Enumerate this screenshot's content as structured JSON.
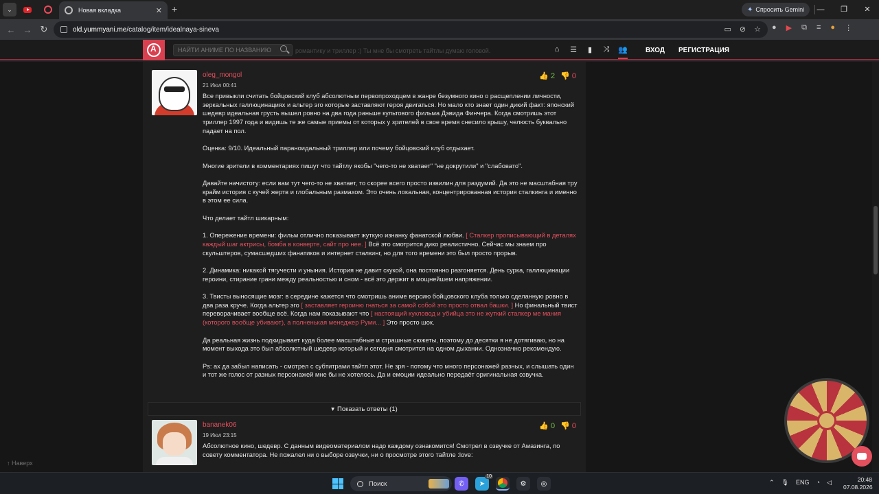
{
  "browser": {
    "active_tab_title": "Новая вкладка",
    "gemini_button": "Спросить Gemini",
    "url_domain": "old.yummyani.me",
    "url_path": "/catalog/item/idealnaya-sineva"
  },
  "site": {
    "search_placeholder": "НАЙТИ АНИМЕ ПО НАЗВАНИЮ",
    "ghost_text": "романтику и триллер :) Ты мне бы смотреть тайтлы думаю головой.",
    "login": "ВХОД",
    "register": "РЕГИСТРАЦИЯ",
    "to_top": "↑ Наверх"
  },
  "comments": [
    {
      "username": "oleg_mongol",
      "date": "21 Июл 00:41",
      "likes": "2",
      "dislikes": "0",
      "p1": "Все привыкли считать бойцовский клуб абсолютным первопроходцем в жанре безумного кино о расщеплении личности, зеркальных галлюцинациях и альтер эго которые заставляют героя двигаться. Но мало кто знает один дикий факт: японский шедевр идеальная грусть вышел ровно на два года раньше культового фильма Дэвида Финчера. Когда смотришь этот триллер 1997 года и видишь те же самые приемы от которых у зрителей в свое время снесило крышу, челюсть буквально падает на пол.",
      "p2": "Оценка: 9/10. Идеальный параноидальный триллер или почему бойцовский клуб отдыхает.",
      "p3": "Многие зрители в комментариях пишут что тайтлу якобы \"чего-то не хватает\" \"не докрутили\" и \"слабовато\".",
      "p4": "Давайте начистоту: если вам тут чего-то не хватает, то скорее всего просто извилин для раздумий. Да это не масштабная тру крайм история с кучей жертв и глобальным размахом. Это очень локальная, концентрированная история сталкинга и именно в этом ее сила.",
      "p5": "Что делает тайтл шикарным:",
      "p6a": " 1. Опережение времени: фильм отлично показывает жуткую изнанку фанатской любви. ",
      "p6b": "[ Сталкер прописывающий в деталях каждый шаг актрисы, бомба в конверте, сайт про нее. ]",
      "p6c": " Всё это смотрится дико реалистично. Сейчас мы знаем про скульштеров, сумасшедших фанатиков и интернет сталкинг, но для того времени это был просто прорыв.",
      "p7": " 2. Динамика: никакой тягучести и уныния. История не давит скукой, она постоянно разгоняется. День сурка, галлюцинации героини, стирание грани между реальностью и сном - всё это держит в мощнейшем напряжении.",
      "p8a": " 3. Твисты выносящие мозг: в середине кажется что смотришь аниме версию бойцовского клуба только сделанную ровно в два раза круче. Когда альтер эго ",
      "p8b": "[ заставляет героиню гнаться за самой собой это просто отвал башки. ]",
      "p8c": " Но финальный твист переворачивает вообще всё. Когда нам показывают что ",
      "p8d": "[ настоящий кукловод и убийца это не жуткий сталкер ме мания (которого вообще убивают), а полненькая менеджер Руми... ]",
      "p8e": " Это просто шок.",
      "p9": "Да реальная жизнь подкидывает куда более масштабные и страшные сюжеты, поэтому до десятки я не дотягиваю, но на момент выхода это был абсолютный шедевр который и сегодня смотрится на одном дыхании. Однозначно рекомендую.",
      "p10": "Ps: ах да забыл написать - смотрел с субтитрами тайтл этот. Не зря - потому что много персонажей разных, и слышать один и тот же голос от разных персонажей мне бы не хотелось. Да и емоции идеально передаёт оригинальная озвучка.",
      "replies": "Показать ответы (1)"
    },
    {
      "username": "bananek06",
      "date": "19 Июл 23:15",
      "likes": "0",
      "dislikes": "0",
      "p1": "Абсолютное кино, шедевр. С данным видеоматериалом надо каждому ознакомится! Смотрел в озвучке от Амазинга, по совету комментатора. Не пожалел ни о выборе озвучки, ни о просмотре этого тайтле :love:"
    }
  ],
  "taskbar": {
    "search_label": "Поиск",
    "lang": "ENG",
    "time": "20:48",
    "date": "07.08.2026",
    "badge": "10"
  }
}
